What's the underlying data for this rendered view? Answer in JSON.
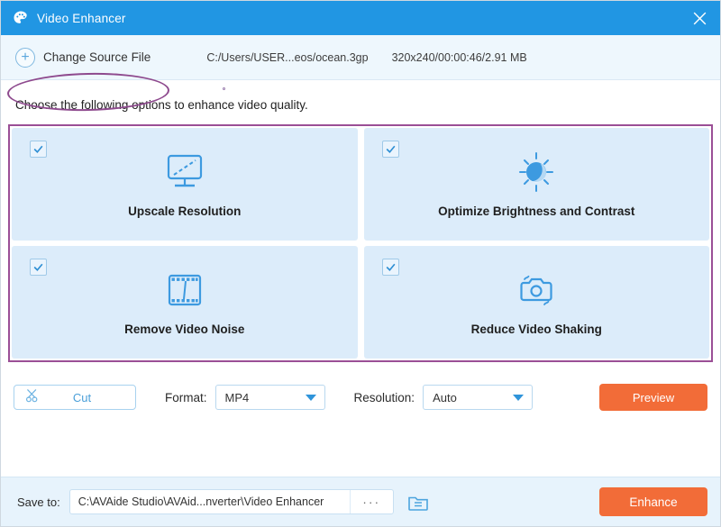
{
  "titlebar": {
    "title": "Video Enhancer",
    "app_icon": "palette-icon",
    "close_icon": "close-icon",
    "background": "#2196e3"
  },
  "source_bar": {
    "change_source_label": "Change Source File",
    "plus_icon": "plus-circle-icon",
    "file_path": "C:/Users/USER...eos/ocean.3gp",
    "file_meta": "320x240/00:00:46/2.91 MB",
    "annotation_color": "#8e4a8e"
  },
  "instruction": "Choose the following options to enhance video quality.",
  "options": {
    "highlight_color": "#9b4f96",
    "card_background": "#dcecfa",
    "icon_color": "#3d9ae0",
    "items": [
      {
        "label": "Upscale Resolution",
        "icon": "monitor-upscale-icon",
        "checked": true
      },
      {
        "label": "Optimize Brightness and Contrast",
        "icon": "sun-brightness-icon",
        "checked": true
      },
      {
        "label": "Remove Video Noise",
        "icon": "film-strip-icon",
        "checked": true
      },
      {
        "label": "Reduce Video Shaking",
        "icon": "camera-shake-icon",
        "checked": true
      }
    ]
  },
  "controls": {
    "cut_label": "Cut",
    "cut_icon": "scissors-icon",
    "format_label": "Format:",
    "format_value": "MP4",
    "format_options": [
      "MP4"
    ],
    "resolution_label": "Resolution:",
    "resolution_value": "Auto",
    "resolution_options": [
      "Auto"
    ],
    "preview_label": "Preview",
    "accent_color": "#f26c38"
  },
  "save_bar": {
    "save_to_label": "Save to:",
    "save_path": "C:\\AVAide Studio\\AVAid...nverter\\Video Enhancer",
    "browse_label": "···",
    "folder_icon": "folder-icon",
    "enhance_label": "Enhance",
    "background": "#e7f3fc"
  }
}
